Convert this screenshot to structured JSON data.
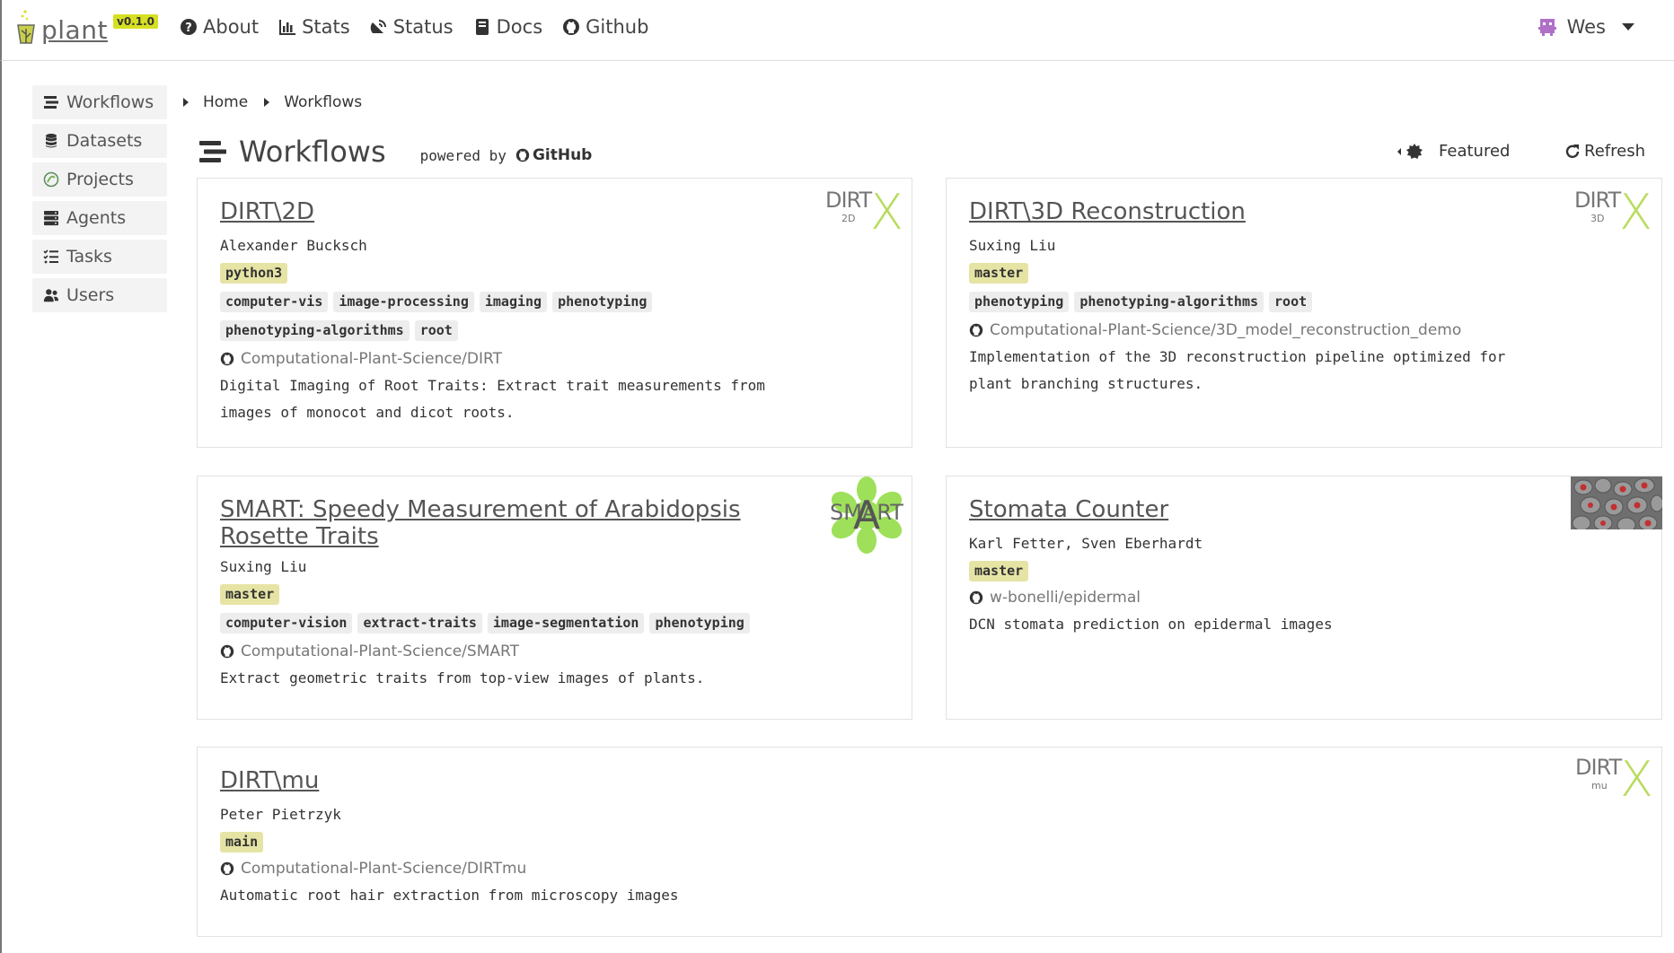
{
  "navbar": {
    "brand": "plant",
    "version": "v0.1.0",
    "links": [
      "About",
      "Stats",
      "Status",
      "Docs",
      "Github"
    ],
    "user": "Wes"
  },
  "sidebar": {
    "items": [
      "Workflows",
      "Datasets",
      "Projects",
      "Agents",
      "Tasks",
      "Users"
    ]
  },
  "breadcrumb": [
    "Home",
    "Workflows"
  ],
  "header": {
    "title": "Workflows",
    "powered_by": "powered by",
    "github_word": "GitHub",
    "featured": "Featured",
    "refresh": "Refresh"
  },
  "workflows": [
    {
      "title": "DIRT\\2D",
      "author": "Alexander Bucksch",
      "branch": "python3",
      "topics_line1": [
        "computer-vis",
        "image-processing",
        "imaging",
        "phenotyping"
      ],
      "topics_line2": [
        "phenotyping-algorithms",
        "root"
      ],
      "repo": "Computational-Plant-Science/DIRT",
      "description_line1": "Digital Imaging of Root Traits: Extract trait measurements from",
      "description_line2": "images of monocot and dicot roots.",
      "logo_text": "DIRT",
      "logo_sub": "2D"
    },
    {
      "title": "DIRT\\3D Reconstruction",
      "author": "Suxing Liu",
      "branch": "master",
      "topics_line1": [
        "phenotyping",
        "phenotyping-algorithms",
        "root"
      ],
      "repo": "Computational-Plant-Science/3D_model_reconstruction_demo",
      "description_line1": "Implementation of the 3D reconstruction pipeline optimized for",
      "description_line2": "plant branching structures.",
      "logo_text": "DIRT",
      "logo_sub": "3D"
    },
    {
      "title_line1": "SMART: Speedy Measurement of Arabidopsis",
      "title_line2": "Rosette Traits",
      "author": "Suxing Liu",
      "branch": "master",
      "topics_line1": [
        "computer-vision",
        "extract-traits",
        "image-segmentation",
        "phenotyping"
      ],
      "repo": "Computational-Plant-Science/SMART",
      "description_line1": "Extract geometric traits from top-view images of plants.",
      "logo_text": "SMART",
      "logo_letter": "A"
    },
    {
      "title": "Stomata Counter",
      "author": "Karl Fetter, Sven Eberhardt",
      "branch": "master",
      "repo": "w-bonelli/epidermal",
      "description_line1": "DCN stomata prediction on epidermal images"
    },
    {
      "title": "DIRT\\mu",
      "author": "Peter Pietrzyk",
      "branch": "main",
      "repo": "Computational-Plant-Science/DIRTmu",
      "description_line1": "Automatic root hair extraction from microscopy images",
      "logo_text": "DIRT",
      "logo_sub": "mu"
    }
  ],
  "colors": {
    "accent": "#d6e022",
    "branch_tag": "#e6e4a5",
    "logo_x": "#b8dc5e"
  }
}
